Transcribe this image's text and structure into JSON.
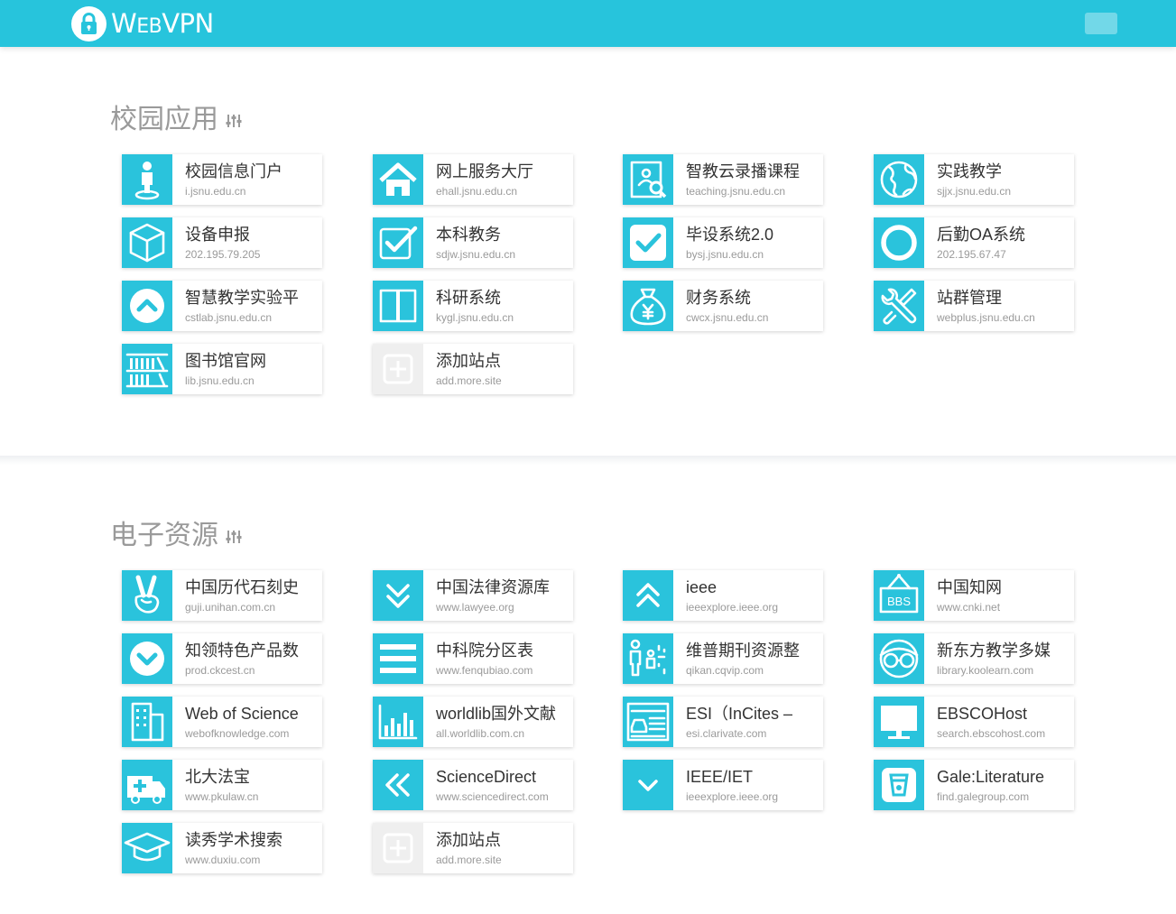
{
  "header": {
    "brand_prefix": "W",
    "brand_small": "EB",
    "brand_suffix": "VPN",
    "brand_full": "WebVPN"
  },
  "sections": {
    "campus": {
      "title": "校园应用",
      "cards": [
        {
          "title": "校园信息门户",
          "url": "i.jsnu.edu.cn",
          "icon": "person-location-icon"
        },
        {
          "title": "网上服务大厅",
          "url": "ehall.jsnu.edu.cn",
          "icon": "home-icon"
        },
        {
          "title": "智教云录播课程",
          "url": "teaching.jsnu.edu.cn",
          "icon": "profile-search-icon"
        },
        {
          "title": "实践教学",
          "url": "sjjx.jsnu.edu.cn",
          "icon": "globe-icon"
        },
        {
          "title": "设备申报",
          "url": "202.195.79.205",
          "icon": "cube-icon"
        },
        {
          "title": "本科教务",
          "url": "sdjw.jsnu.edu.cn",
          "icon": "checkbox-icon"
        },
        {
          "title": "毕设系统2.0",
          "url": "bysj.jsnu.edu.cn",
          "icon": "check-square-icon"
        },
        {
          "title": "后勤OA系统",
          "url": "202.195.67.47",
          "icon": "circle-icon"
        },
        {
          "title": "智慧教学实验平",
          "url": "cstlab.jsnu.edu.cn",
          "icon": "chevron-up-circle-icon"
        },
        {
          "title": "科研系统",
          "url": "kygl.jsnu.edu.cn",
          "icon": "columns-icon"
        },
        {
          "title": "财务系统",
          "url": "cwcx.jsnu.edu.cn",
          "icon": "money-bag-icon"
        },
        {
          "title": "站群管理",
          "url": "webplus.jsnu.edu.cn",
          "icon": "tools-icon"
        },
        {
          "title": "图书馆官网",
          "url": "lib.jsnu.edu.cn",
          "icon": "bookshelf-icon"
        },
        {
          "title": "添加站点",
          "url": "add.more.site",
          "icon": "add-icon",
          "add": true
        }
      ]
    },
    "resources": {
      "title": "电子资源",
      "cards": [
        {
          "title": "中国历代石刻史",
          "url": "guji.unihan.com.cn",
          "icon": "victory-hand-icon"
        },
        {
          "title": "中国法律资源库",
          "url": "www.lawyee.org",
          "icon": "double-chevron-down-icon"
        },
        {
          "title": "ieee",
          "url": "ieeexplore.ieee.org",
          "icon": "double-chevron-up-icon"
        },
        {
          "title": "中国知网",
          "url": "www.cnki.net",
          "icon": "bbs-sign-icon"
        },
        {
          "title": "知领特色产品数",
          "url": "prod.ckcest.cn",
          "icon": "chevron-down-circle-icon"
        },
        {
          "title": "中科院分区表",
          "url": "www.fenqubiao.com",
          "icon": "menu-icon"
        },
        {
          "title": "维普期刊资源整",
          "url": "qikan.cqvip.com",
          "icon": "family-icon"
        },
        {
          "title": "新东方教学多媒",
          "url": "library.koolearn.com",
          "icon": "glasses-face-icon"
        },
        {
          "title": "Web of Science",
          "url": "webofknowledge.com",
          "icon": "building-icon"
        },
        {
          "title": "worldlib国外文献",
          "url": "all.worldlib.com.cn",
          "icon": "bar-chart-icon"
        },
        {
          "title": "ESI（InCites –",
          "url": "esi.clarivate.com",
          "icon": "car-list-icon"
        },
        {
          "title": "EBSCOHost",
          "url": "search.ebscohost.com",
          "icon": "monitor-icon"
        },
        {
          "title": "北大法宝",
          "url": "www.pkulaw.cn",
          "icon": "ambulance-icon"
        },
        {
          "title": "ScienceDirect",
          "url": "www.sciencedirect.com",
          "icon": "double-chevron-left-icon"
        },
        {
          "title": "IEEE/IET",
          "url": "ieeexplore.ieee.org",
          "icon": "chevron-down-icon"
        },
        {
          "title": "Gale:Literature",
          "url": "find.galegroup.com",
          "icon": "cup-icon"
        },
        {
          "title": "读秀学术搜索",
          "url": "www.duxiu.com",
          "icon": "graduation-cap-icon"
        },
        {
          "title": "添加站点",
          "url": "add.more.site",
          "icon": "add-icon",
          "add": true
        }
      ]
    }
  },
  "colors": {
    "header": "#27c4dc",
    "icon_bg": "#2ac3dc",
    "add_icon_bg": "#efefef",
    "section_title": "#9a9a9a"
  }
}
